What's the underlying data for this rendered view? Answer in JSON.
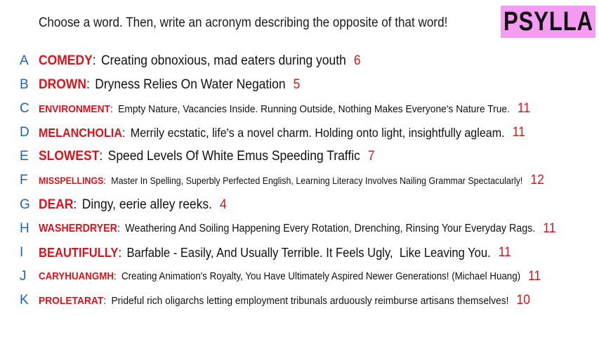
{
  "header": {
    "instructions": "Choose a word. Then, write an acronym describing the opposite of that word!",
    "brand": "PSYLLA",
    "brand_color": "#f49cf2"
  },
  "colors": {
    "letter": "#1f63b8",
    "word": "#d8131b",
    "text": "#111111"
  },
  "entries": [
    {
      "letter": "A",
      "word": "COMEDY",
      "acronym": "Creating obnoxious, mad eaters during youth",
      "count": "6"
    },
    {
      "letter": "B",
      "word": "DROWN",
      "acronym": "Dryness Relies On Water Negation",
      "count": "5"
    },
    {
      "letter": "C",
      "word": "ENVIRONMENT",
      "acronym": "Empty Nature, Vacancies Inside. Running Outside, Nothing Makes Everyone's Nature True.",
      "count": "11"
    },
    {
      "letter": "D",
      "word": "MELANCHOLIA",
      "acronym": "Merrily ecstatic, life's a novel charm. Holding onto light, insightfully agleam.",
      "count": "11"
    },
    {
      "letter": "E",
      "word": "SLOWEST",
      "acronym": "Speed Levels Of White Emus Speeding Traffic",
      "count": "7"
    },
    {
      "letter": "F",
      "word": "MISSPELLINGS",
      "acronym": "Master In Spelling, Superbly Perfected English, Learning Literacy Involves Nailing Grammar Spectacularly!",
      "count": "12"
    },
    {
      "letter": "G",
      "word": "DEAR",
      "acronym": "Dingy, eerie alley reeks.",
      "count": "4"
    },
    {
      "letter": "H",
      "word": "WASHERDRYER",
      "acronym": "Weathering And Soiling Happening Every Rotation, Drenching, Rinsing Your Everyday Rags.",
      "count": "11"
    },
    {
      "letter": "I",
      "word": "BEAUTIFULLY",
      "acronym": "Barfable - Easily, And Usually Terrible. It Feels Ugly,  Like Leaving You.",
      "count": "11"
    },
    {
      "letter": "J",
      "word": "CARYHUANGMH",
      "acronym": "Creating Animation's Royalty, You Have Ultimately Aspired Newer Generations! (Michael Huang)",
      "count": "11"
    },
    {
      "letter": "K",
      "word": "PROLETARAT",
      "acronym": "Prideful rich oligarchs letting employment tribunals arduously reimburse artisans themselves!",
      "count": "10"
    }
  ]
}
